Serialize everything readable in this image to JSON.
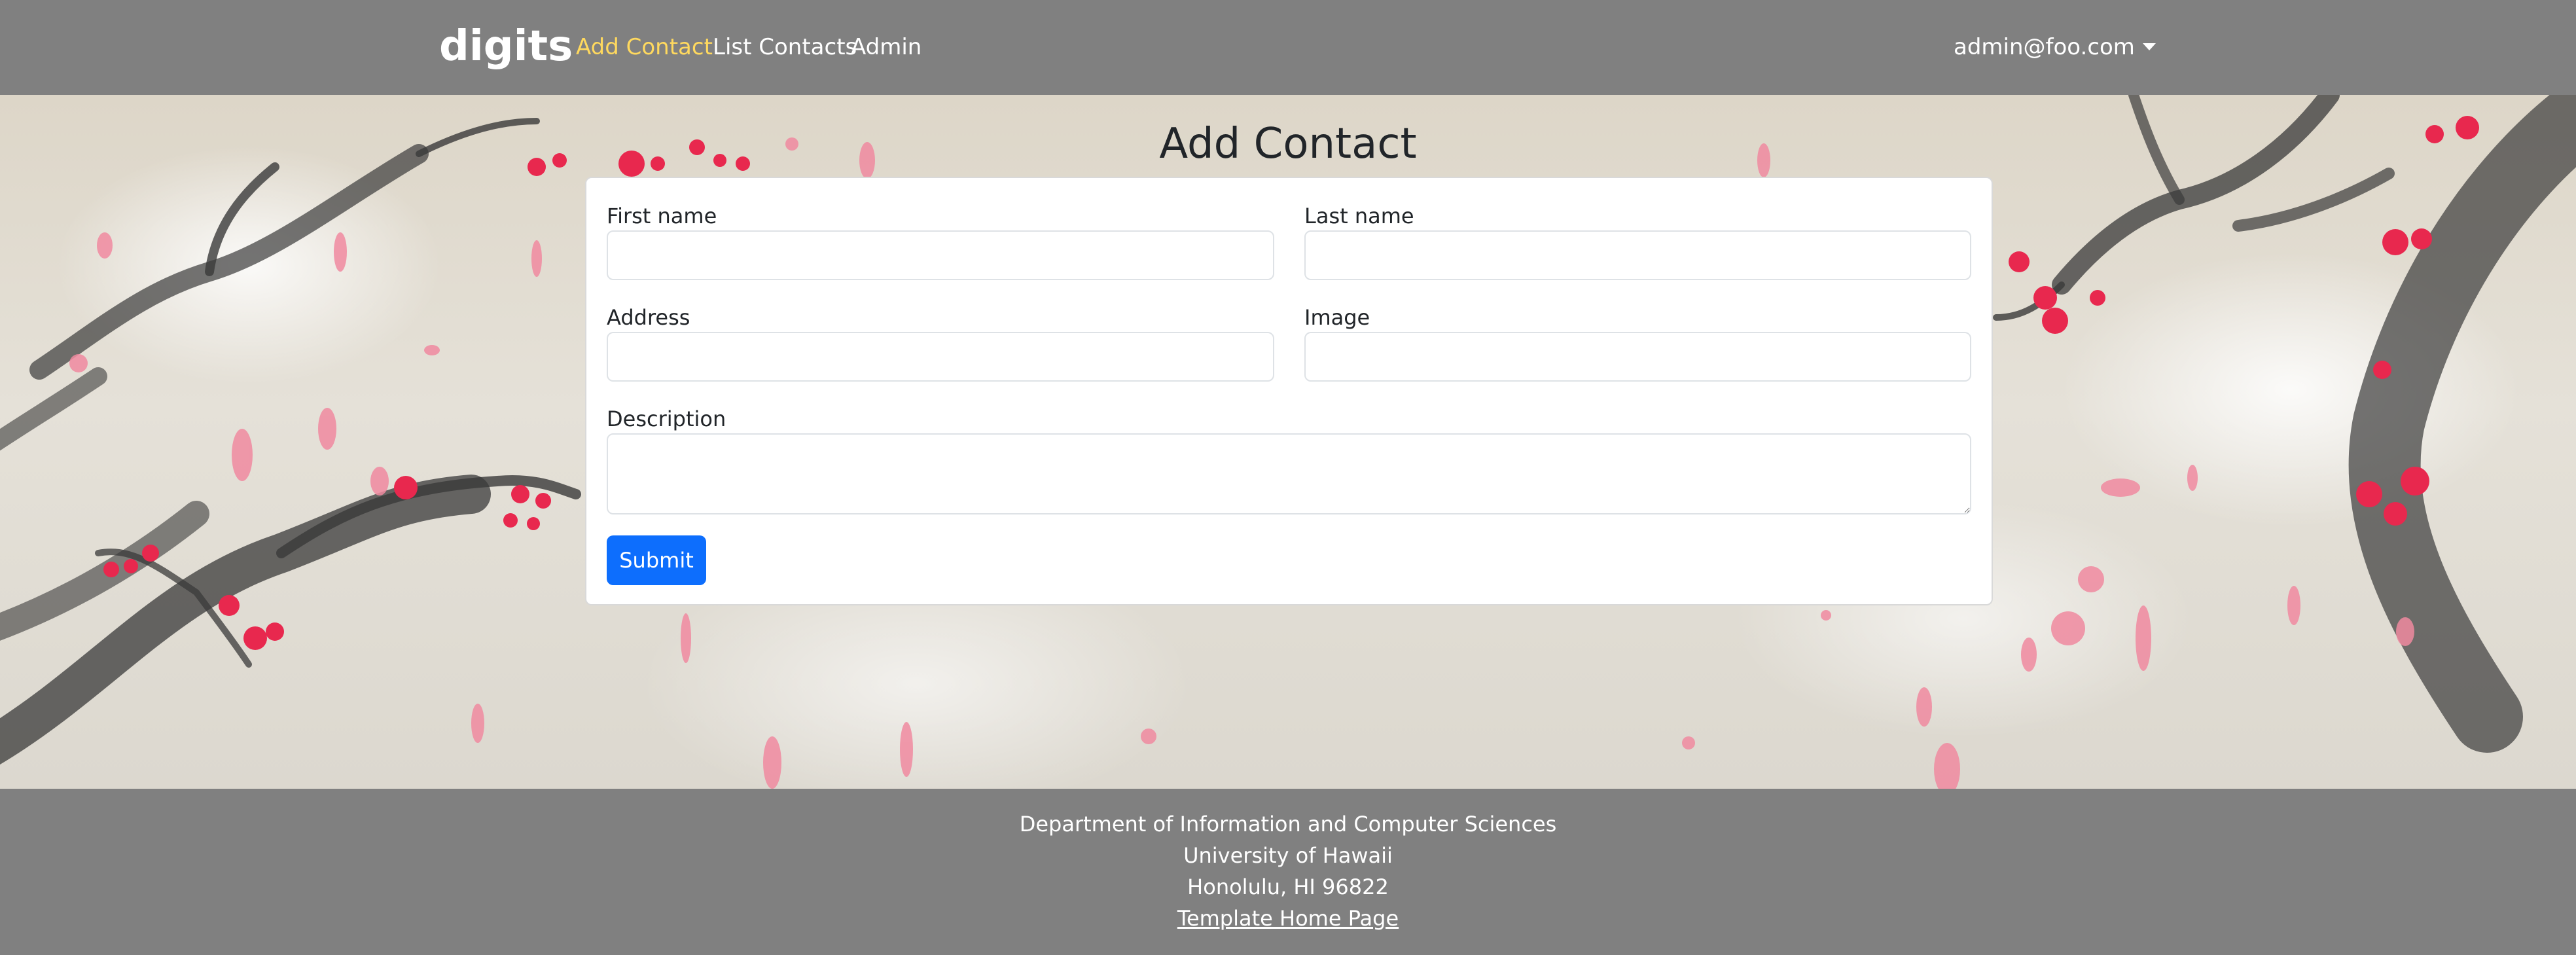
{
  "navbar": {
    "brand": "digits",
    "links": [
      {
        "label": "Add Contact",
        "active": true
      },
      {
        "label": "List Contacts",
        "active": false
      },
      {
        "label": "Admin",
        "active": false
      }
    ],
    "user_menu": "admin@foo.com"
  },
  "page": {
    "title": "Add Contact"
  },
  "form": {
    "first_name": {
      "label": "First name",
      "value": ""
    },
    "last_name": {
      "label": "Last name",
      "value": ""
    },
    "address": {
      "label": "Address",
      "value": ""
    },
    "image": {
      "label": "Image",
      "value": ""
    },
    "description": {
      "label": "Description",
      "value": ""
    },
    "submit_label": "Submit"
  },
  "footer": {
    "line1": "Department of Information and Computer Sciences",
    "line2": "University of Hawaii",
    "line3": "Honolulu, HI 96822",
    "link": "Template Home Page"
  },
  "colors": {
    "navbar_bg": "#808080",
    "active_link": "#ffd95e",
    "primary_button": "#0d6efd",
    "blossom": "#e8284e",
    "petal": "#f08aa0"
  }
}
